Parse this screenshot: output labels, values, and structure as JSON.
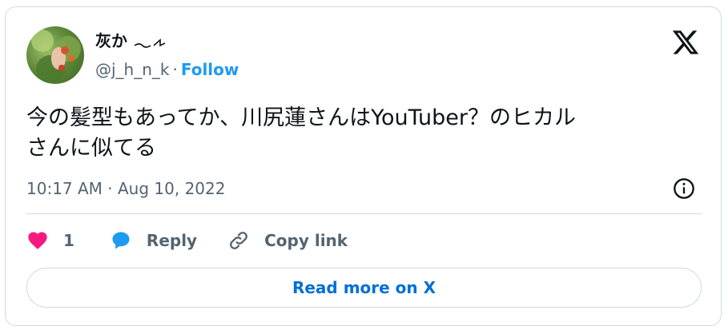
{
  "tweet": {
    "author": {
      "display_name": "灰か",
      "handle": "@j_h_n_k",
      "separator": "·",
      "follow_label": "Follow"
    },
    "text": "今の髪型もあってか、川尻蓮さんはYouTuber？のヒカル\nさんに似てる",
    "timestamp": "10:17 AM · Aug 10, 2022",
    "like_count": "1",
    "reply_label": "Reply",
    "copy_link_label": "Copy link",
    "read_more_label": "Read more on X"
  },
  "colors": {
    "like": "#f91880",
    "reply": "#1d9bf0",
    "link": "#1d9bf0",
    "read_more": "#006fd6",
    "secondary_text": "#536471",
    "border": "#cfd9de"
  },
  "icons": {
    "brand": "x-logo-icon",
    "info": "info-icon",
    "like": "heart-icon",
    "reply": "speech-bubble-icon",
    "copy": "link-icon"
  }
}
